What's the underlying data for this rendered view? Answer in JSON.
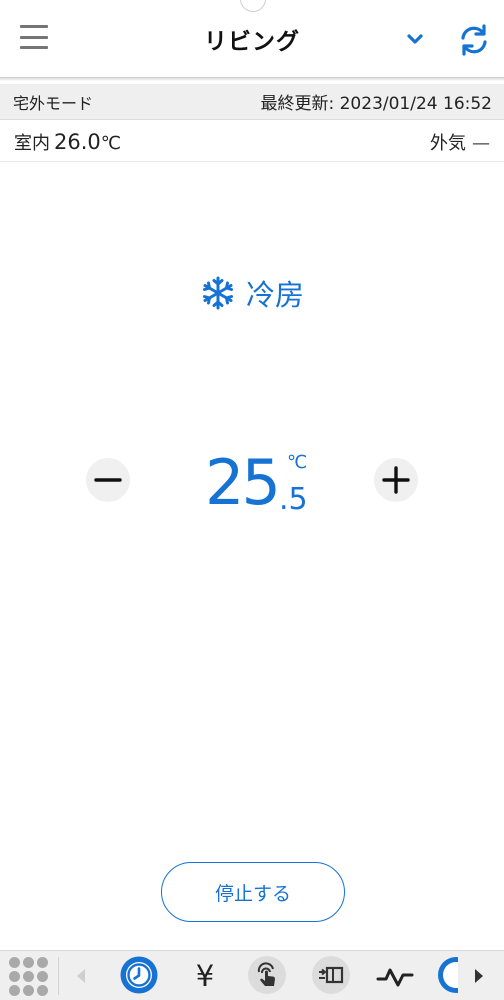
{
  "header": {
    "room_name": "リビング"
  },
  "status": {
    "mode": "宅外モード",
    "last_updated": "最終更新: 2023/01/24 16:52"
  },
  "temperatures": {
    "indoor_label": "室内",
    "indoor_value": "26.0",
    "indoor_unit": "℃",
    "outdoor_label": "外気",
    "outdoor_value": "—"
  },
  "operation": {
    "mode_label": "冷房",
    "mode_icon": "snowflake-icon",
    "setpoint_integer": "25",
    "setpoint_decimal": ".5",
    "setpoint_unit": "℃"
  },
  "actions": {
    "stop_label": "停止する"
  },
  "bottom_bar": {
    "yen_glyph": "¥",
    "icons": [
      "grid-icon",
      "arrow-left-icon",
      "timer-icon",
      "yen-icon",
      "touch-icon",
      "display-icon",
      "pulse-icon",
      "arrow-right-icon"
    ]
  },
  "colors": {
    "accent": "#1673d4",
    "text": "#222222",
    "status_bar_bg": "#efefef",
    "button_bg": "#f0f0f0"
  }
}
